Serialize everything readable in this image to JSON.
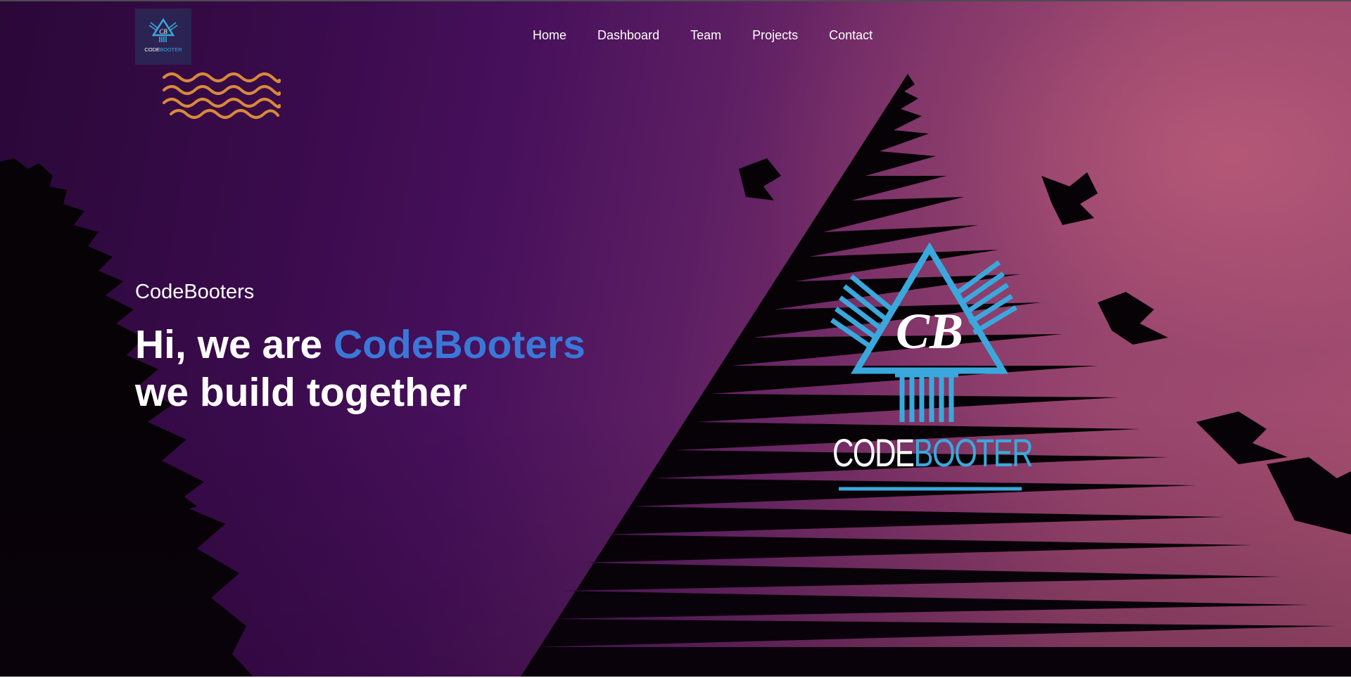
{
  "brand": {
    "logo_icon": "codebooter-logo-icon",
    "logo_text_code": "CODE",
    "logo_text_booter": "BOOTER",
    "logo_initials": "CB"
  },
  "nav": {
    "items": [
      {
        "label": "Home"
      },
      {
        "label": "Dashboard"
      },
      {
        "label": "Team"
      },
      {
        "label": "Projects"
      },
      {
        "label": "Contact"
      }
    ]
  },
  "hero": {
    "eyebrow": "CodeBooters",
    "headline_prefix": "Hi, we are ",
    "headline_accent": "CodeBooters",
    "headline_line2": "we build together"
  },
  "big_logo": {
    "initials": "CB",
    "text_code": "CODE",
    "text_booter": "BOOTER"
  },
  "colors": {
    "accent_blue": "#3a78d8",
    "logo_cyan": "#3aa8dc",
    "wave_orange": "#d98a3a",
    "logo_tile_bg": "#2b2352"
  }
}
